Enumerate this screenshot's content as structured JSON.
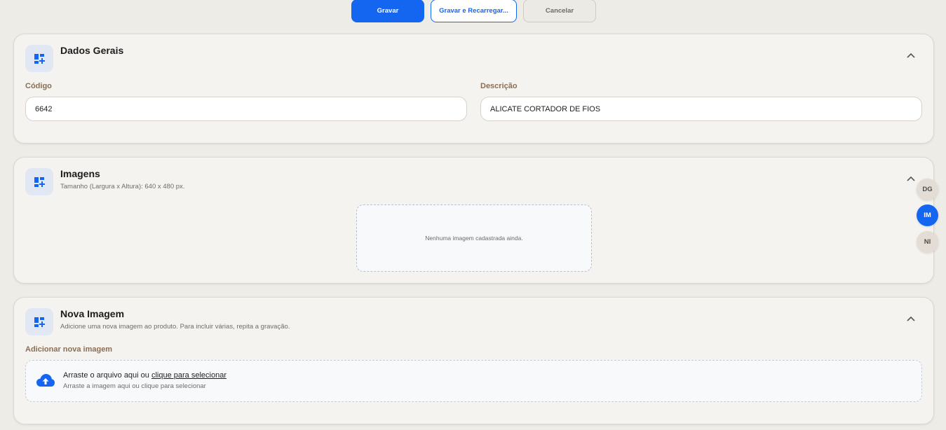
{
  "toolbar": {
    "save_label": "Gravar",
    "save_reload_label": "Gravar e Recarregar...",
    "cancel_label": "Cancelar"
  },
  "colors": {
    "accent": "#1466f0",
    "label": "#8a6e55",
    "background": "#eeece7",
    "card": "#f5f3ef"
  },
  "sections": {
    "general": {
      "title": "Dados Gerais",
      "icon": "dashboard-add-icon",
      "fields": {
        "code": {
          "label": "Código",
          "value": "6642"
        },
        "description": {
          "label": "Descrição",
          "value": "ALICATE CORTADOR DE FIOS"
        }
      }
    },
    "images": {
      "title": "Imagens",
      "subtitle": "Tamanho (Largura x Altura): 640 x 480 px.",
      "icon": "dashboard-add-icon",
      "empty_text": "Nenhuma imagem cadastrada ainda."
    },
    "new_image": {
      "title": "Nova Imagem",
      "subtitle": "Adicione uma nova imagem ao produto. Para incluir várias, repita a gravação.",
      "icon": "dashboard-add-icon",
      "field_label": "Adicionar nova imagem",
      "dropzone": {
        "text": "Arraste o arquivo aqui ou ",
        "link": "clique para selecionar",
        "hint": "Arraste a imagem aqui ou clique para selecionar",
        "icon": "cloud-upload-icon"
      }
    }
  },
  "side_nav": {
    "items": [
      {
        "label": "DG",
        "active": false
      },
      {
        "label": "IM",
        "active": true
      },
      {
        "label": "NI",
        "active": false
      }
    ]
  }
}
